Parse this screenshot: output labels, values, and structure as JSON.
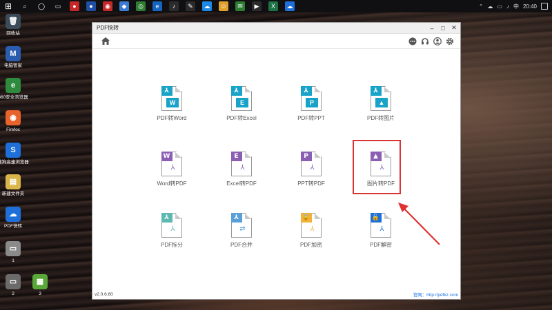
{
  "taskbar": {
    "icons": [
      {
        "name": "windows-start-icon",
        "glyph": "⊞",
        "color": "#101012"
      },
      {
        "name": "search-icon",
        "glyph": "⌕",
        "color": "#101012"
      },
      {
        "name": "cortana-icon",
        "glyph": "◯",
        "color": "#101012"
      },
      {
        "name": "task-view-icon",
        "glyph": "▭",
        "color": "#101012"
      },
      {
        "name": "app-red-icon",
        "glyph": "●",
        "color": "#c62828"
      },
      {
        "name": "app-blue-icon",
        "glyph": "●",
        "color": "#1e4fa3"
      },
      {
        "name": "app-record-icon",
        "glyph": "◉",
        "color": "#c62828"
      },
      {
        "name": "app-shield-icon",
        "glyph": "◆",
        "color": "#3a7bd5"
      },
      {
        "name": "chrome-icon",
        "glyph": "◎",
        "color": "#2e7d32"
      },
      {
        "name": "app-edge-icon",
        "glyph": "e",
        "color": "#1565c0"
      },
      {
        "name": "app-music-icon",
        "glyph": "♪",
        "color": "#2b2b2b"
      },
      {
        "name": "app-pen-icon",
        "glyph": "✎",
        "color": "#2b2b2b"
      },
      {
        "name": "app-cloud-icon",
        "glyph": "☁",
        "color": "#1e88e5"
      },
      {
        "name": "app-smile-icon",
        "glyph": "☺",
        "color": "#e0a030"
      },
      {
        "name": "wechat-icon",
        "glyph": "✉",
        "color": "#2e7d32"
      },
      {
        "name": "app-video-icon",
        "glyph": "▶",
        "color": "#2b2b2b"
      },
      {
        "name": "excel-icon",
        "glyph": "X",
        "color": "#1e7145"
      },
      {
        "name": "pdf-app-taskbar-icon",
        "glyph": "☁",
        "color": "#1e6fd9"
      }
    ],
    "clock": "20:40",
    "ime": "中"
  },
  "desktop": {
    "icons": [
      {
        "label": "回收站",
        "glyph": "🗑",
        "color": "#3b4b5a"
      },
      {
        "label": "电脑管家",
        "glyph": "M",
        "color": "#2a5db0"
      },
      {
        "label": "360安全浏览器",
        "glyph": "e",
        "color": "#2e8b3d"
      },
      {
        "label": "Firefox",
        "glyph": "◉",
        "color": "#e8622c"
      },
      {
        "label": "搜狗高速浏览器",
        "glyph": "S",
        "color": "#1e6fd9"
      },
      {
        "label": "新建文件夹",
        "glyph": "▤",
        "color": "#d9b54a"
      },
      {
        "label": "PDF快转",
        "glyph": "☁",
        "color": "#1e6fd9"
      },
      {
        "label": "1",
        "glyph": "▭",
        "color": "#8a8a8a"
      },
      {
        "label": "2",
        "glyph": "▭",
        "color": "#6b6b6b"
      },
      {
        "label": "3",
        "glyph": "▦",
        "color": "#5ba83a"
      }
    ]
  },
  "window": {
    "title": "PDF快转",
    "version": "v2.0.6.60",
    "website": "官网：http://pdfkz.com"
  },
  "tools": [
    {
      "label": "PDF转Word",
      "badge": "⅄",
      "badge_color": "#1aa3c8",
      "letter": "W",
      "letter_color": "#1aa3c8"
    },
    {
      "label": "PDF转Excel",
      "badge": "⅄",
      "badge_color": "#1aa3c8",
      "letter": "E",
      "letter_color": "#1aa3c8"
    },
    {
      "label": "PDF转PPT",
      "badge": "⅄",
      "badge_color": "#1aa3c8",
      "letter": "P",
      "letter_color": "#1aa3c8"
    },
    {
      "label": "PDF转图片",
      "badge": "⅄",
      "badge_color": "#1aa3c8",
      "letter": "▲",
      "letter_color": "#1aa3c8"
    },
    {
      "label": "Word转PDF",
      "badge": "W",
      "badge_color": "#8b60b4",
      "sym": "⅄",
      "sym_color": "#8b60b4"
    },
    {
      "label": "Excel转PDF",
      "badge": "E",
      "badge_color": "#8b60b4",
      "sym": "⅄",
      "sym_color": "#8b60b4"
    },
    {
      "label": "PPT转PDF",
      "badge": "P",
      "badge_color": "#8b60b4",
      "sym": "⅄",
      "sym_color": "#8b60b4"
    },
    {
      "label": "图片转PDF",
      "badge": "▲",
      "badge_color": "#8b60b4",
      "sym": "⅄",
      "sym_color": "#8b60b4"
    },
    {
      "label": "PDF拆分",
      "badge": "⅄",
      "badge_color": "#5cb8b0",
      "sym": "⅄",
      "sym_color": "#5cb8b0"
    },
    {
      "label": "PDF合并",
      "badge": "⅄",
      "badge_color": "#5aa0d8",
      "sym": "⇄",
      "sym_color": "#5aa0d8"
    },
    {
      "label": "PDF加密",
      "badge": "🔒",
      "badge_color": "#f2b23a",
      "sym": "⅄",
      "sym_color": "#f2b23a"
    },
    {
      "label": "PDF解密",
      "badge": "🔓",
      "badge_color": "#1e6fd9",
      "sym": "⅄",
      "sym_color": "#1e6fd9"
    }
  ]
}
